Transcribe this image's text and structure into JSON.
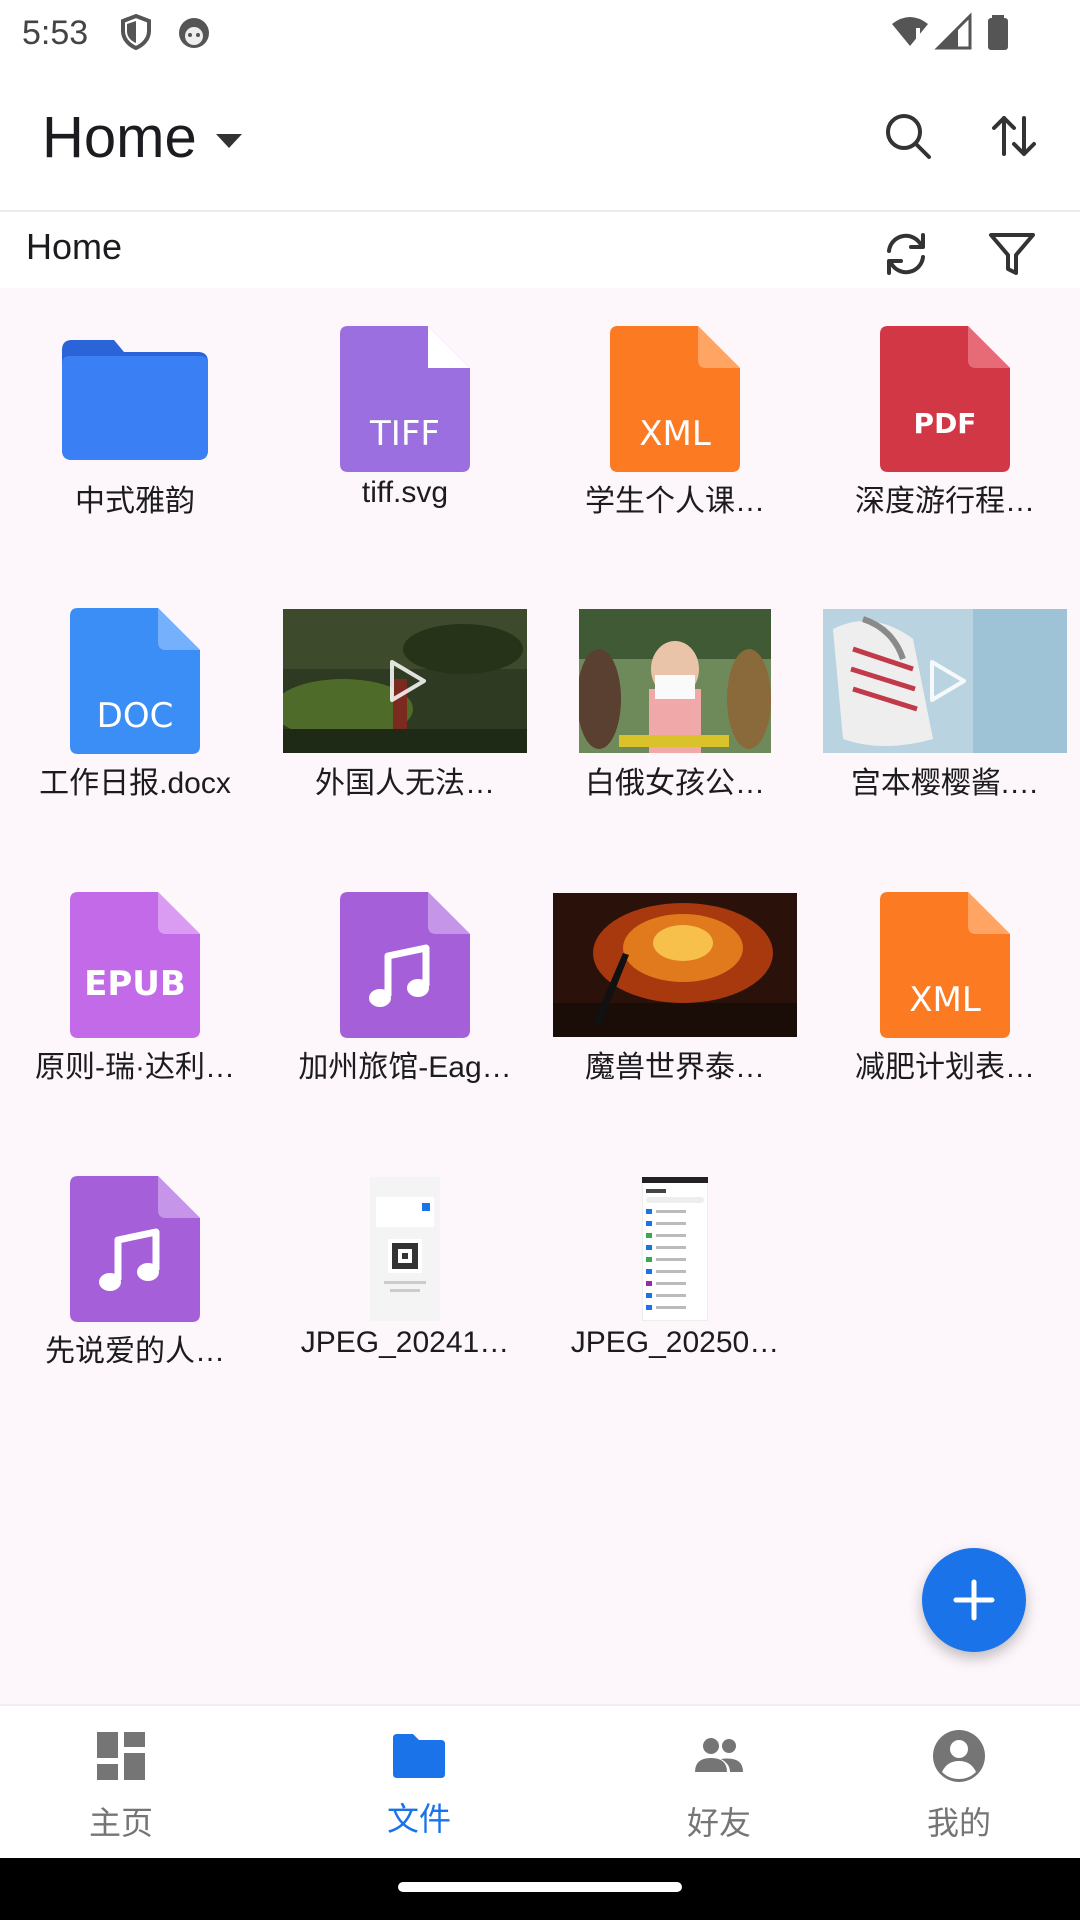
{
  "status_bar": {
    "time": "5:53",
    "icons": [
      "shield-icon",
      "face-icon",
      "wifi-icon",
      "signal-icon",
      "battery-icon"
    ]
  },
  "app_bar": {
    "title": "Home",
    "actions": [
      "search-icon",
      "sort-icon"
    ]
  },
  "path_bar": {
    "label": "Home",
    "actions": [
      "refresh-icon",
      "filter-icon"
    ]
  },
  "files": [
    {
      "name": "中式雅韵",
      "kind": "folder"
    },
    {
      "name": "tiff.svg",
      "kind": "doc",
      "badge": "TIFF",
      "color": "#9c6fe0"
    },
    {
      "name": "学生个人课…",
      "kind": "doc",
      "badge": "XML",
      "color": "#fb7a22"
    },
    {
      "name": "深度游行程…",
      "kind": "doc",
      "badge": "PDF",
      "color": "#d23746"
    },
    {
      "name": "工作日报.docx",
      "kind": "doc",
      "badge": "DOC",
      "color": "#3a8ef6"
    },
    {
      "name": "外国人无法…",
      "kind": "video"
    },
    {
      "name": "白俄女孩公…",
      "kind": "video"
    },
    {
      "name": "宫本樱樱酱.…",
      "kind": "video"
    },
    {
      "name": "原则-瑞·达利…",
      "kind": "doc",
      "badge": "EPUB",
      "color": "#c36ae8"
    },
    {
      "name": "加州旅馆-Eag…",
      "kind": "audio",
      "color": "#a55fd9"
    },
    {
      "name": "魔兽世界泰…",
      "kind": "video"
    },
    {
      "name": "减肥计划表…",
      "kind": "doc",
      "badge": "XML",
      "color": "#fb7a22"
    },
    {
      "name": "先说爱的人…",
      "kind": "audio",
      "color": "#a55fd9"
    },
    {
      "name": "JPEG_20241…",
      "kind": "image"
    },
    {
      "name": "JPEG_20250…",
      "kind": "image"
    }
  ],
  "fab": {
    "icon": "plus-icon"
  },
  "bottom_nav": [
    {
      "label": "主页",
      "icon": "dashboard-icon",
      "active": false
    },
    {
      "label": "文件",
      "icon": "folder-icon",
      "active": true
    },
    {
      "label": "好友",
      "icon": "people-icon",
      "active": false
    },
    {
      "label": "我的",
      "icon": "account-icon",
      "active": false
    }
  ],
  "colors": {
    "accent": "#1a73e8",
    "background": "#fdf7fb",
    "folder": "#3b7ff5"
  }
}
